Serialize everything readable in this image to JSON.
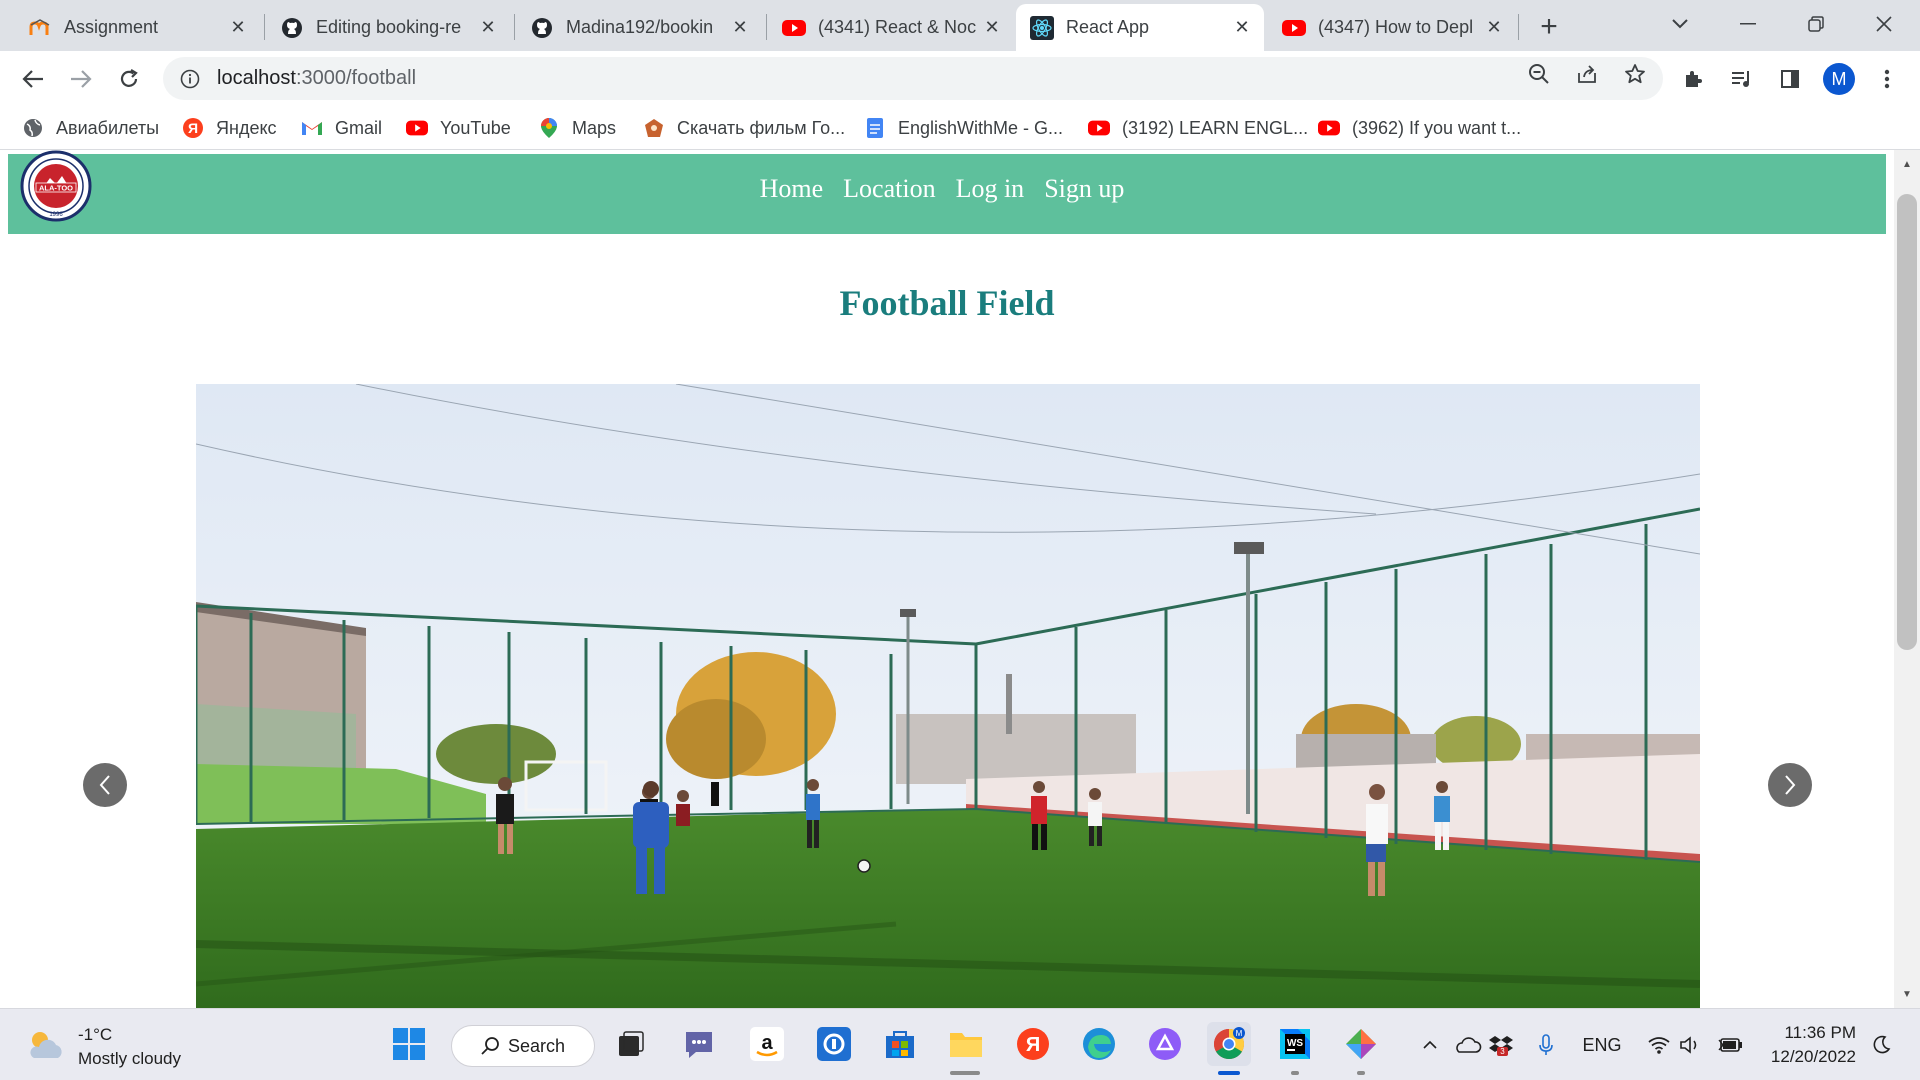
{
  "browser": {
    "tabs": [
      {
        "title": "Assignment",
        "icon": "moodle-icon",
        "active": false
      },
      {
        "title": "Editing booking-re",
        "icon": "github-icon",
        "active": false
      },
      {
        "title": "Madina192/bookin",
        "icon": "github-icon",
        "active": false
      },
      {
        "title": "(4341) React & Noc",
        "icon": "youtube-icon",
        "active": false
      },
      {
        "title": "React App",
        "icon": "react-icon",
        "active": true
      },
      {
        "title": "(4347) How to Depl",
        "icon": "youtube-icon",
        "active": false
      }
    ],
    "url_host": "localhost",
    "url_path": ":3000/football",
    "profile_initial": "M",
    "bookmarks": [
      {
        "label": "Авиабилеты",
        "icon": "globe-icon"
      },
      {
        "label": "Яндекс",
        "icon": "yandex-icon"
      },
      {
        "label": "Gmail",
        "icon": "gmail-icon"
      },
      {
        "label": "YouTube",
        "icon": "youtube-icon"
      },
      {
        "label": "Maps",
        "icon": "maps-icon"
      },
      {
        "label": "Скачать фильм Го...",
        "icon": "film-icon"
      },
      {
        "label": "EnglishWithMe - G...",
        "icon": "docs-icon"
      },
      {
        "label": "(3192) LEARN ENGL...",
        "icon": "youtube-icon"
      },
      {
        "label": "(3962) If you want t...",
        "icon": "youtube-icon"
      }
    ]
  },
  "page": {
    "logo_text": "ALA-TOO",
    "logo_year": "1996",
    "nav": [
      "Home",
      "Location",
      "Log in",
      "Sign up"
    ],
    "title": "Football Field",
    "carousel": {
      "prev_icon": "chevron-left-icon",
      "next_icon": "chevron-right-icon"
    }
  },
  "taskbar": {
    "weather_temp": "-1°C",
    "weather_desc": "Mostly cloudy",
    "search_label": "Search",
    "language": "ENG",
    "notification_count": "3",
    "time": "11:36 PM",
    "date": "12/20/2022"
  },
  "colors": {
    "nav_green": "#5ec09c",
    "title_teal": "#1a7d7d",
    "tab_strip": "#dee1e6",
    "taskbar": "#e9eaf1"
  }
}
